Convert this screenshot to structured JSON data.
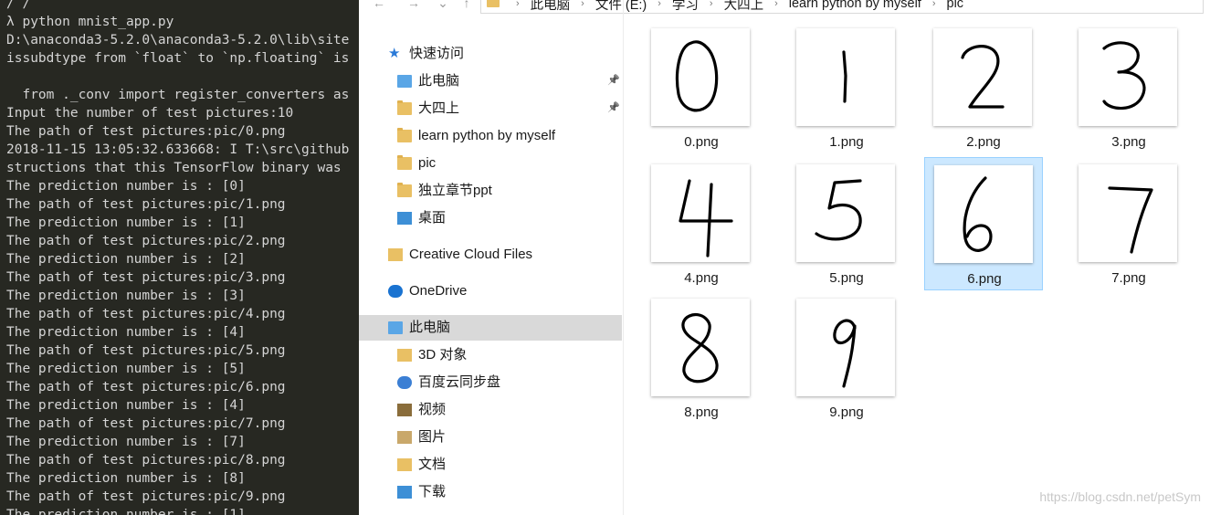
{
  "terminal": {
    "lines": [
      "/ /",
      "λ python mnist_app.py",
      "D:\\anaconda3-5.2.0\\anaconda3-5.2.0\\lib\\site",
      "issubdtype from `float` to `np.floating` is",
      "",
      "  from ._conv import register_converters as",
      "Input the number of test pictures:10",
      "The path of test pictures:pic/0.png",
      "2018-11-15 13:05:32.633668: I T:\\src\\github",
      "structions that this TensorFlow binary was",
      "The prediction number is : [0]",
      "The path of test pictures:pic/1.png",
      "The prediction number is : [1]",
      "The path of test pictures:pic/2.png",
      "The prediction number is : [2]",
      "The path of test pictures:pic/3.png",
      "The prediction number is : [3]",
      "The path of test pictures:pic/4.png",
      "The prediction number is : [4]",
      "The path of test pictures:pic/5.png",
      "The prediction number is : [5]",
      "The path of test pictures:pic/6.png",
      "The prediction number is : [4]",
      "The path of test pictures:pic/7.png",
      "The prediction number is : [7]",
      "The path of test pictures:pic/8.png",
      "The prediction number is : [8]",
      "The path of test pictures:pic/9.png",
      "The prediction number is : [1]"
    ]
  },
  "explorer": {
    "nav_buttons": {
      "back": "←",
      "forward": "→",
      "recent": "⌄",
      "up": "↑"
    },
    "breadcrumb": [
      "此电脑",
      "文件 (E:)",
      "学习",
      "大四上",
      "learn python by myself",
      "pic"
    ],
    "nav_pane": {
      "items": [
        {
          "label": "快速访问",
          "icon": "star-icon",
          "pinned": false
        },
        {
          "label": "此电脑",
          "icon": "computer-icon",
          "pinned": true
        },
        {
          "label": "大四上",
          "icon": "folder-icon",
          "pinned": true
        },
        {
          "label": "learn python by myself",
          "icon": "folder-icon",
          "pinned": false
        },
        {
          "label": "pic",
          "icon": "folder-icon",
          "pinned": false
        },
        {
          "label": "独立章节ppt",
          "icon": "folder-icon",
          "pinned": false
        },
        {
          "label": "桌面",
          "icon": "desktop-folder-icon",
          "pinned": false
        },
        {
          "label": "Creative Cloud Files",
          "icon": "creative-cloud-icon",
          "pinned": false
        },
        {
          "label": "OneDrive",
          "icon": "cloud-icon",
          "pinned": false
        },
        {
          "label": "此电脑",
          "icon": "computer-icon",
          "pinned": false,
          "selected": true
        },
        {
          "label": "3D 对象",
          "icon": "3d-objects-icon",
          "pinned": false
        },
        {
          "label": "百度云同步盘",
          "icon": "baidu-cloud-icon",
          "pinned": false
        },
        {
          "label": "视频",
          "icon": "video-folder-icon",
          "pinned": false
        },
        {
          "label": "图片",
          "icon": "pictures-folder-icon",
          "pinned": false
        },
        {
          "label": "文档",
          "icon": "documents-folder-icon",
          "pinned": false
        },
        {
          "label": "下载",
          "icon": "downloads-folder-icon",
          "pinned": false
        }
      ]
    },
    "files": [
      {
        "name": "0.png",
        "digit": "0",
        "selected": false
      },
      {
        "name": "1.png",
        "digit": "1",
        "selected": false
      },
      {
        "name": "2.png",
        "digit": "2",
        "selected": false
      },
      {
        "name": "3.png",
        "digit": "3",
        "selected": false
      },
      {
        "name": "4.png",
        "digit": "4",
        "selected": false
      },
      {
        "name": "5.png",
        "digit": "5",
        "selected": false
      },
      {
        "name": "6.png",
        "digit": "6",
        "selected": true
      },
      {
        "name": "7.png",
        "digit": "7",
        "selected": false
      },
      {
        "name": "8.png",
        "digit": "8",
        "selected": false
      },
      {
        "name": "9.png",
        "digit": "9",
        "selected": false
      }
    ]
  },
  "watermark": "https://blog.csdn.net/petSym",
  "colors": {
    "terminal_bg": "#272822",
    "terminal_text": "#d4d4d4",
    "selection_bg": "#cce8ff",
    "selection_border": "#99d1ff",
    "nav_selected_bg": "#d9d9d9",
    "folder": "#e9c064"
  }
}
